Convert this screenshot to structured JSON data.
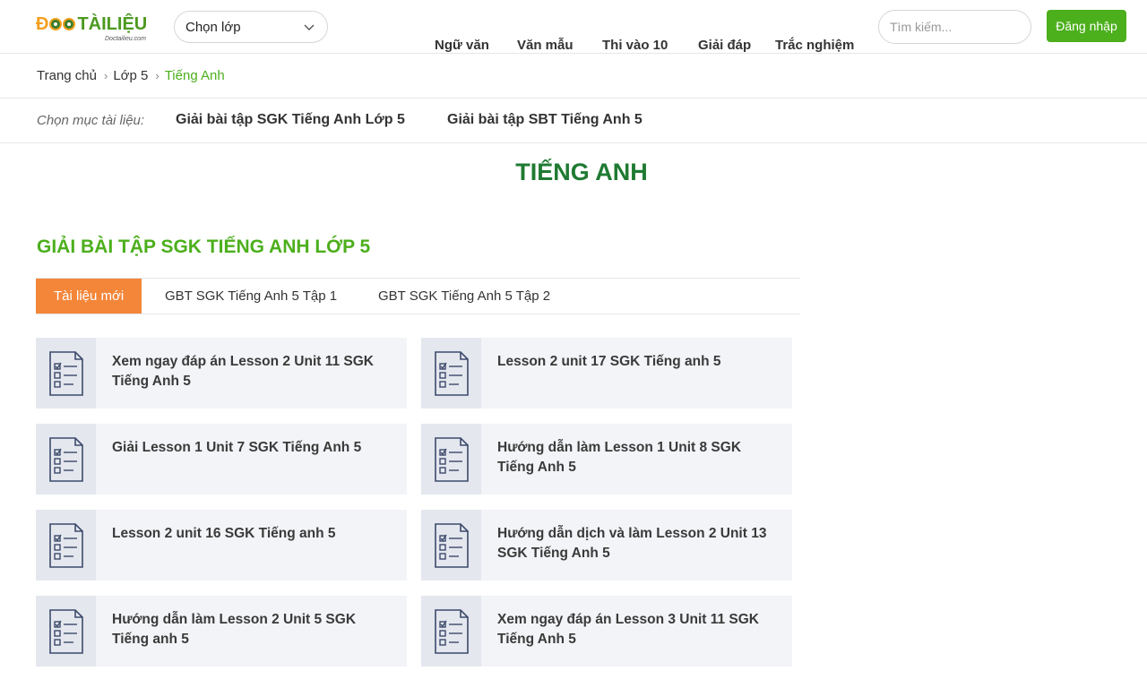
{
  "header": {
    "logo": {
      "part1": "Đ",
      "part2": "TÀILIỆU",
      "sub": "Doctailieu.com"
    },
    "class_select": "Chọn lớp",
    "nav": [
      "Ngữ văn",
      "Văn mẫu",
      "Thi vào 10",
      "Giải đáp",
      "Trắc nghiệm"
    ],
    "search_placeholder": "Tìm kiếm...",
    "login": "Đăng nhập"
  },
  "breadcrumb": {
    "items": [
      "Trang chủ",
      "Lớp 5"
    ],
    "active": "Tiếng Anh",
    "separator": "›"
  },
  "catbar": {
    "label": "Chọn mục tài liệu:",
    "links": [
      "Giải bài tập SGK Tiếng Anh Lớp 5",
      "Giải bài tập SBT Tiếng Anh 5"
    ]
  },
  "page_title": "TIẾNG ANH",
  "section": {
    "title": "GIẢI BÀI TẬP SGK TIẾNG ANH LỚP 5",
    "tabs": [
      "Tài liệu mới",
      "GBT SGK Tiếng Anh 5 Tập 1",
      "GBT SGK Tiếng Anh 5 Tập 2"
    ],
    "cards": [
      "Xem ngay đáp án Lesson 2 Unit 11 SGK Tiếng Anh 5",
      "Lesson 2 unit 17 SGK Tiếng anh 5",
      "Giải Lesson 1 Unit 7 SGK Tiếng Anh 5",
      "Hướng dẫn làm Lesson 1 Unit 8 SGK Tiếng Anh 5",
      "Lesson 2 unit 16 SGK Tiếng anh 5",
      "Hướng dẫn dịch và làm Lesson 2 Unit 13 SGK Tiếng Anh 5",
      "Hướng dẫn làm Lesson 2 Unit 5 SGK Tiếng anh 5",
      "Xem ngay đáp án Lesson 3 Unit 11 SGK Tiếng Anh 5"
    ]
  },
  "colors": {
    "brand_green": "#4caf1c",
    "title_green": "#1f7a32",
    "tab_orange": "#f4863a"
  },
  "icons": [
    "chevron-down-icon",
    "document-checklist-icon"
  ]
}
